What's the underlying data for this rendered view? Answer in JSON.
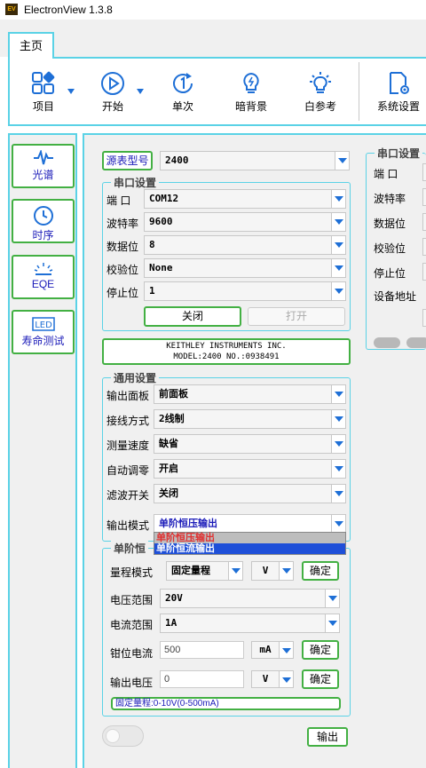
{
  "window": {
    "title": "ElectronView 1.3.8",
    "icon_text": "EV"
  },
  "tabs": [
    {
      "label": "主页",
      "active": true
    }
  ],
  "ribbon": {
    "items": [
      {
        "label": "项目",
        "icon": "project-grid-icon",
        "dropdown": true
      },
      {
        "label": "开始",
        "icon": "play-circle-icon",
        "dropdown": true
      },
      {
        "label": "单次",
        "icon": "single-run-icon"
      },
      {
        "label": "暗背景",
        "icon": "bulb-off-icon"
      },
      {
        "label": "白参考",
        "icon": "bulb-on-icon"
      },
      {
        "label": "系统设置",
        "icon": "doc-gear-icon"
      }
    ]
  },
  "left_nav": [
    {
      "label": "光谱",
      "icon": "spectrum-pulse-icon"
    },
    {
      "label": "时序",
      "icon": "clock-icon"
    },
    {
      "label": "EQE",
      "icon": "sunrise-icon"
    },
    {
      "label": "寿命测试",
      "icon": "led-icon"
    }
  ],
  "source": {
    "label": "源表型号",
    "model": "2400",
    "serial": {
      "title": "串口设置",
      "rows": [
        {
          "label": "端  口",
          "value": "COM12"
        },
        {
          "label": "波特率",
          "value": "9600"
        },
        {
          "label": "数据位",
          "value": "8"
        },
        {
          "label": "校验位",
          "value": "None"
        },
        {
          "label": "停止位",
          "value": "1"
        }
      ],
      "close_label": "关闭",
      "open_label": "打开"
    },
    "id_line1": "KEITHLEY INSTRUMENTS INC.",
    "id_line2": "MODEL:2400 NO.:0938491"
  },
  "general": {
    "title": "通用设置",
    "rows": [
      {
        "label": "输出面板",
        "value": "前面板"
      },
      {
        "label": "接线方式",
        "value": "2线制"
      },
      {
        "label": "测量速度",
        "value": "缺省"
      },
      {
        "label": "自动调零",
        "value": "开启"
      },
      {
        "label": "滤波开关",
        "value": "关闭"
      }
    ],
    "output_mode_label": "输出模式",
    "output_mode_value": "单阶恒压输出",
    "output_mode_options": [
      {
        "label": "单阶恒压输出",
        "color": "#e03030"
      },
      {
        "label": "单阶恒流输出",
        "color": "#ffffff",
        "highlight": "#1e4fd8"
      }
    ]
  },
  "step": {
    "title": "单阶恒",
    "range_mode_label": "量程模式",
    "range_mode_value": "固定量程",
    "range_unit": "V",
    "confirm_label": "确定",
    "voltage_range_label": "电压范围",
    "voltage_range_value": "20V",
    "current_range_label": "电流范围",
    "current_range_value": "1A",
    "clamp_label": "钳位电流",
    "clamp_value": "500",
    "clamp_unit": "mA",
    "output_v_label": "输出电压",
    "output_v_value": "0",
    "output_v_unit": "V",
    "info": "固定量程:0-10V(0-500mA)"
  },
  "output_button": "输出",
  "right_serial": {
    "title": "串口设置",
    "labels": [
      "端  口",
      "波特率",
      "数据位",
      "校验位",
      "停止位",
      "设备地址"
    ]
  },
  "colors": {
    "accent_cyan": "#5ad2e6",
    "green_border": "#43b043",
    "blue_text": "#1a1ab8",
    "arrow_blue": "#1e6fd6"
  }
}
